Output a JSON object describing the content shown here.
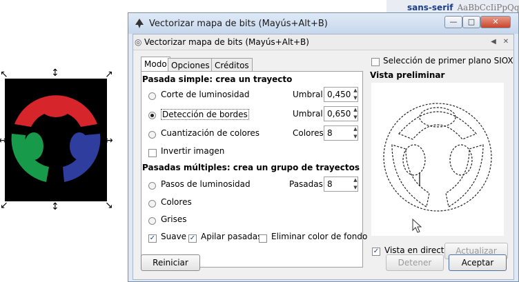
{
  "background": {
    "font_family_label": "sans-serif",
    "font_preview": "AaBbCcIiPpQq"
  },
  "window": {
    "title": "Vectorizar mapa de bits (Mayús+Alt+B)",
    "dock_title": "Vectorizar mapa de bits (Mayús+Alt+B)",
    "controls": {
      "minimize": "—",
      "maximize": "□",
      "close": "✕"
    }
  },
  "tabs": [
    {
      "label": "Modo",
      "active": true
    },
    {
      "label": "Opciones",
      "active": false
    },
    {
      "label": "Créditos",
      "active": false
    }
  ],
  "single_scan": {
    "heading": "Pasada simple: crea un trayecto",
    "options": [
      {
        "label": "Corte de luminosidad",
        "param_label": "Umbral:",
        "value": "0,450",
        "selected": false
      },
      {
        "label": "Detección de bordes",
        "param_label": "Umbral:",
        "value": "0,650",
        "selected": true
      },
      {
        "label": "Cuantización de colores",
        "param_label": "Colores:",
        "value": "8",
        "selected": false
      }
    ],
    "invert_label": "Invertir imagen",
    "invert_checked": false
  },
  "multi_scan": {
    "heading": "Pasadas múltiples: crea un grupo de trayectos",
    "options": [
      {
        "label": "Pasos de luminosidad",
        "param_label": "Pasadas:",
        "value": "8",
        "selected": false
      },
      {
        "label": "Colores",
        "selected": false
      },
      {
        "label": "Grises",
        "selected": false
      }
    ],
    "smooth_label": "Suave",
    "smooth_checked": true,
    "stack_label": "Apilar pasadas",
    "stack_checked": true,
    "remove_bg_label": "Eliminar color de fondo",
    "remove_bg_checked": false
  },
  "siox": {
    "label": "Selección de primer plano SIOX",
    "checked": false
  },
  "preview": {
    "heading": "Vista preliminar",
    "live_label": "Vista en directo",
    "live_checked": true,
    "update_label": "Actualizar"
  },
  "buttons": {
    "reset": "Reiniciar",
    "stop": "Detener",
    "ok": "Aceptar"
  },
  "colors": {
    "logo_red": "#d7252c",
    "logo_green": "#179a4a",
    "logo_blue": "#2f3e9e",
    "titlebar": "#c6d7ec"
  }
}
